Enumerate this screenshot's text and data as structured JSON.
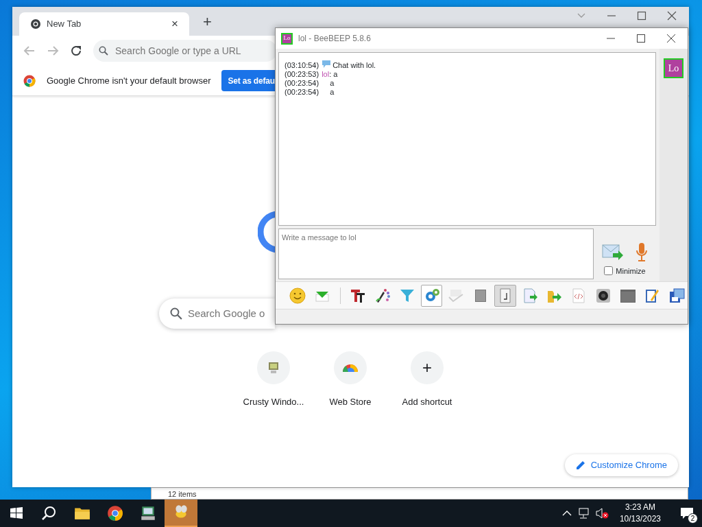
{
  "chrome": {
    "tab": {
      "title": "New Tab",
      "close": "×",
      "selected": true
    },
    "new_tab": "+",
    "omnibox": {
      "placeholder": "Search Google or type a URL"
    },
    "infobar": {
      "text": "Google Chrome isn't your default browser",
      "button": "Set as defau"
    },
    "search": {
      "placeholder": "Search Google o"
    },
    "shortcuts": [
      {
        "label": "Crusty Windo...",
        "kind": "computer"
      },
      {
        "label": "Web Store",
        "kind": "store"
      },
      {
        "label": "Add shortcut",
        "kind": "add",
        "symbol": "+"
      }
    ],
    "customize": "Customize Chrome"
  },
  "explorer_status": "12 items",
  "beebeep": {
    "title_icon": "Lo",
    "title": "lol - BeeBEEP 5.8.6",
    "avatar": "Lo",
    "messages": [
      {
        "time": "(03:10:54)",
        "kind": "system",
        "text": "Chat with lol."
      },
      {
        "time": "(00:23:53)",
        "kind": "user",
        "sender": "lol",
        "text": ": a"
      },
      {
        "time": "(00:23:54)",
        "kind": "user",
        "text": "a"
      },
      {
        "time": "(00:23:54)",
        "kind": "user",
        "text": "a"
      }
    ],
    "input": {
      "placeholder": "Write a message to lol"
    },
    "minimize": {
      "label": "Minimize",
      "checked": false
    },
    "toolbar": [
      {
        "pressed": false,
        "disabled": false,
        "hovered": false
      },
      {
        "pressed": false,
        "disabled": false,
        "hovered": false
      },
      {
        "pressed": false,
        "disabled": false,
        "hovered": false
      },
      {
        "pressed": false,
        "disabled": false,
        "hovered": false
      },
      {
        "pressed": false,
        "disabled": false,
        "hovered": false
      },
      {
        "pressed": false,
        "disabled": false,
        "hovered": true
      },
      {
        "pressed": false,
        "disabled": true,
        "hovered": false
      },
      {
        "pressed": false,
        "disabled": false,
        "hovered": false
      },
      {
        "pressed": true,
        "disabled": false,
        "hovered": false
      },
      {
        "pressed": false,
        "disabled": false,
        "hovered": false
      },
      {
        "pressed": false,
        "disabled": false,
        "hovered": false
      },
      {
        "pressed": false,
        "disabled": false,
        "hovered": false
      },
      {
        "pressed": false,
        "disabled": false,
        "hovered": false
      },
      {
        "pressed": false,
        "disabled": false,
        "hovered": false
      },
      {
        "pressed": false,
        "disabled": false,
        "hovered": false
      },
      {
        "pressed": false,
        "disabled": false,
        "hovered": false
      }
    ]
  },
  "taskbar": {
    "apps": [
      {
        "selected": false
      },
      {
        "selected": false
      },
      {
        "selected": false
      },
      {
        "selected": true
      }
    ],
    "time": "3:23 AM",
    "date": "10/13/2023",
    "notifications": "2"
  }
}
